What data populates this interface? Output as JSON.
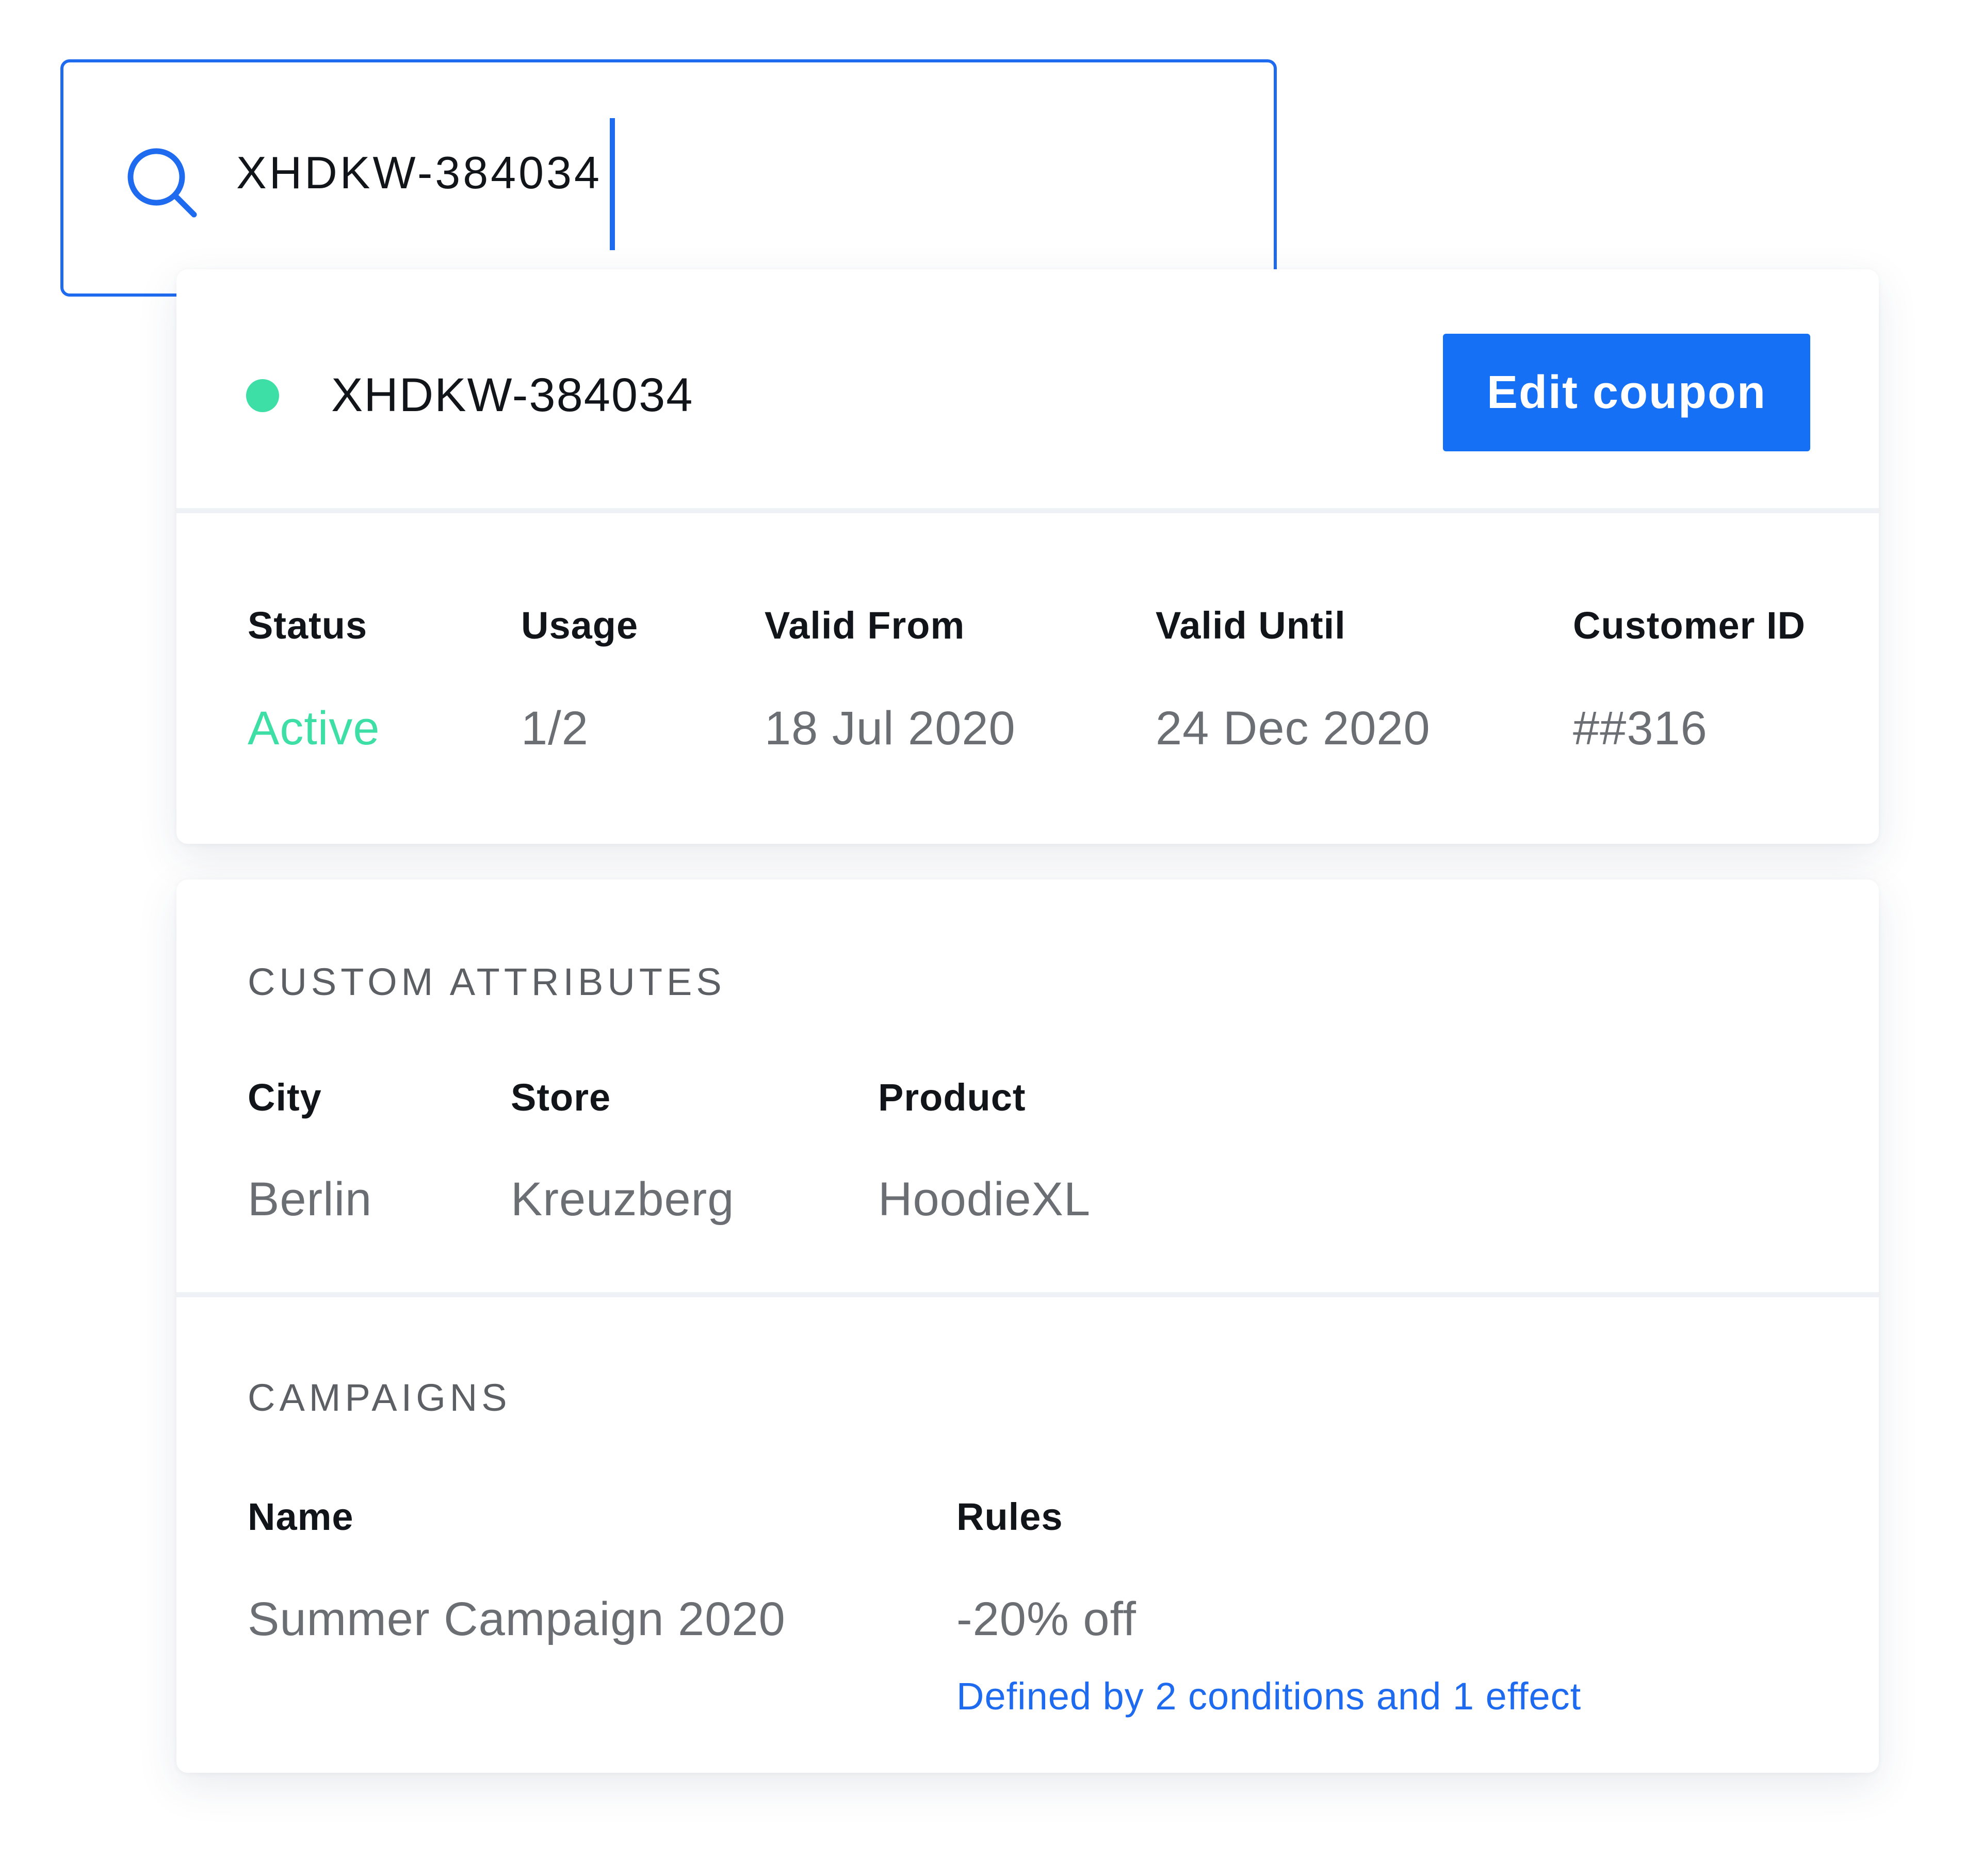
{
  "search": {
    "value": "XHDKW-384034"
  },
  "coupon": {
    "code": "XHDKW-384034",
    "edit_label": "Edit coupon",
    "status_color": "#3DDFA6",
    "fields": [
      {
        "label": "Status",
        "value": "Active"
      },
      {
        "label": "Usage",
        "value": "1/2"
      },
      {
        "label": "Valid From",
        "value": "18 Jul 2020"
      },
      {
        "label": "Valid Until",
        "value": "24 Dec 2020"
      },
      {
        "label": "Customer ID",
        "value": "##316"
      }
    ]
  },
  "custom_attributes": {
    "title": "CUSTOM ATTRIBUTES",
    "fields": [
      {
        "label": "City",
        "value": "Berlin"
      },
      {
        "label": "Store",
        "value": "Kreuzberg"
      },
      {
        "label": "Product",
        "value": "HoodieXL"
      }
    ]
  },
  "campaigns": {
    "title": "CAMPAIGNS",
    "name_label": "Name",
    "rules_label": "Rules",
    "name_value": "Summer Campaign 2020",
    "rules_value": "-20% off",
    "rules_detail": "Defined by 2 conditions and 1 effect"
  },
  "colors": {
    "accent": "#1570F5",
    "active": "#3DDFA6",
    "muted_text": "#6B6E73"
  },
  "icons": {
    "search": "search-icon"
  }
}
